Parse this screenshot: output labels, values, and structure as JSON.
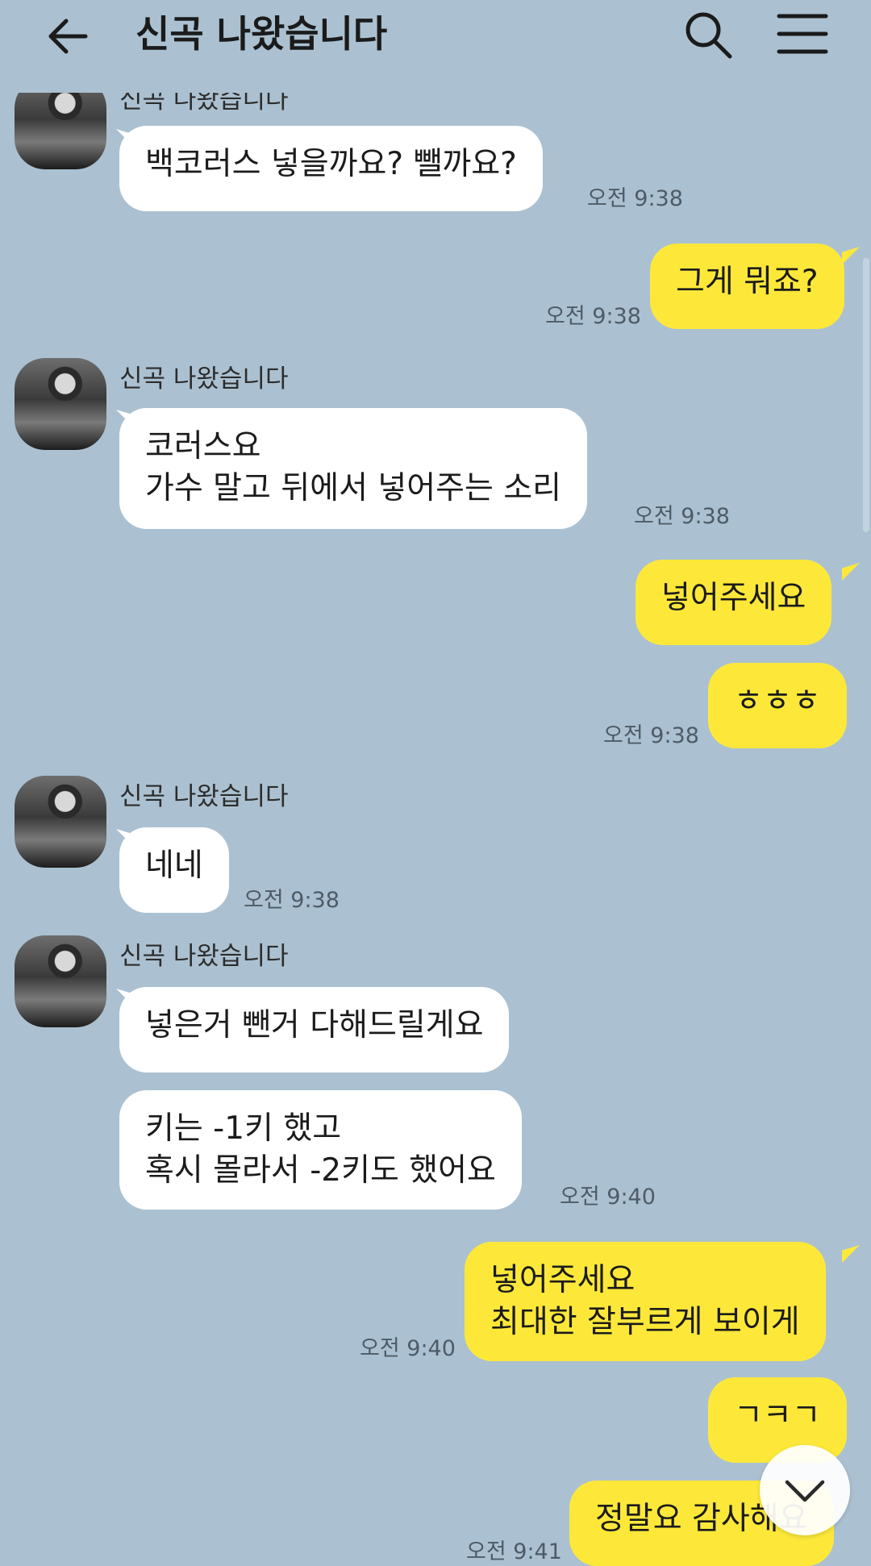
{
  "header": {
    "title": "신곡 나왔습니다",
    "back_icon": "back-arrow-icon",
    "search_icon": "search-icon",
    "menu_icon": "menu-icon"
  },
  "colors": {
    "background": "#abc1d1",
    "incoming_bubble": "#ffffff",
    "outgoing_bubble": "#fde83a"
  },
  "messages": [
    {
      "direction": "in",
      "sender": "신곡 나왔습니다",
      "lines": [
        "백코러스 넣을까요? 뺄까요?"
      ],
      "time": "오전 9:38"
    },
    {
      "direction": "out",
      "lines": [
        "그게 뭐죠?"
      ],
      "time": "오전 9:38"
    },
    {
      "direction": "in",
      "sender": "신곡 나왔습니다",
      "lines": [
        "코러스요",
        "가수 말고 뒤에서 넣어주는 소리"
      ],
      "time": "오전 9:38"
    },
    {
      "direction": "out",
      "lines": [
        "넣어주세요"
      ],
      "time": ""
    },
    {
      "direction": "out",
      "lines": [
        "ㅎㅎㅎ"
      ],
      "time": "오전 9:38"
    },
    {
      "direction": "in",
      "sender": "신곡 나왔습니다",
      "lines": [
        "네네"
      ],
      "time": "오전 9:38"
    },
    {
      "direction": "in",
      "sender": "신곡 나왔습니다",
      "lines": [
        "넣은거 뺀거 다해드릴게요"
      ],
      "time": ""
    },
    {
      "direction": "in",
      "lines": [
        "키는 -1키 했고",
        "혹시 몰라서 -2키도 했어요"
      ],
      "time": "오전 9:40"
    },
    {
      "direction": "out",
      "lines": [
        "넣어주세요",
        "최대한 잘부르게 보이게"
      ],
      "time": "오전 9:40"
    },
    {
      "direction": "out",
      "lines": [
        "ㄱㅋㄱ"
      ],
      "time": ""
    },
    {
      "direction": "out",
      "lines": [
        "정말요 감사해요"
      ],
      "time": "오전 9:41"
    }
  ],
  "scroll_down_icon": "chevron-down-icon"
}
